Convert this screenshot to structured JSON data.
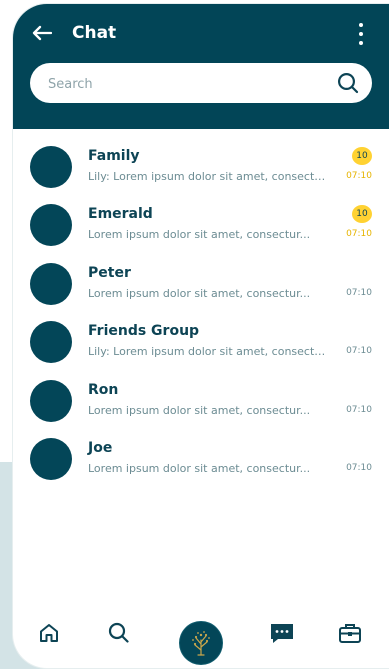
{
  "header": {
    "title": "Chat",
    "back_icon": "arrow-left-icon",
    "menu_icon": "more-vertical-icon"
  },
  "search": {
    "placeholder": "Search",
    "icon": "search-icon"
  },
  "chats": [
    {
      "name": "Family",
      "preview": "Lily: Lorem ipsum dolor sit amet, consectur...",
      "time": "07:10",
      "badge": "10",
      "unread": true
    },
    {
      "name": "Emerald",
      "preview": "Lorem ipsum dolor sit amet, consectur...",
      "time": "07:10",
      "badge": "10",
      "unread": true
    },
    {
      "name": "Peter",
      "preview": "Lorem ipsum dolor sit amet, consectur...",
      "time": "07:10",
      "badge": "",
      "unread": false
    },
    {
      "name": "Friends Group",
      "preview": "Lily: Lorem ipsum dolor sit amet, consectur...",
      "time": "07:10",
      "badge": "",
      "unread": false
    },
    {
      "name": "Ron",
      "preview": "Lorem ipsum dolor sit amet, consectur...",
      "time": "07:10",
      "badge": "",
      "unread": false
    },
    {
      "name": "Joe",
      "preview": "Lorem ipsum dolor sit amet, consectur...",
      "time": "07:10",
      "badge": "",
      "unread": false
    }
  ],
  "bottom_nav": {
    "items": [
      "home-icon",
      "search-icon",
      "tree-logo-icon",
      "chat-bubble-icon",
      "briefcase-icon"
    ]
  },
  "colors": {
    "primary": "#024557",
    "accent": "#ffd232",
    "unread_time": "#e6b400",
    "muted_text": "#6c8c93"
  }
}
